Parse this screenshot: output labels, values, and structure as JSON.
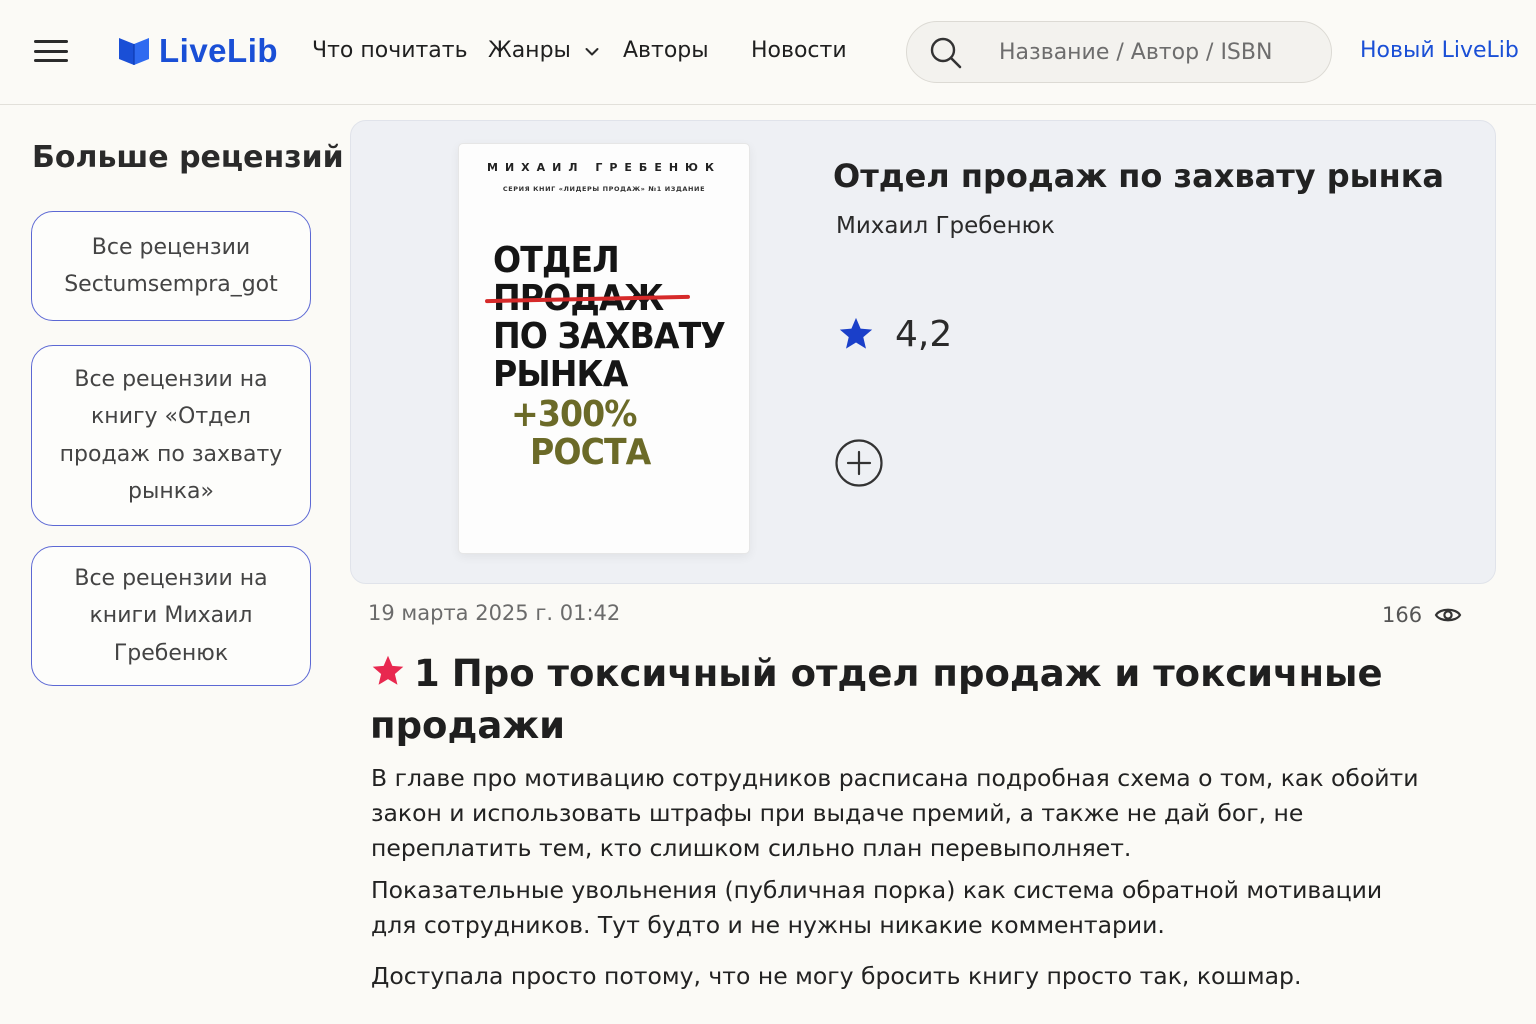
{
  "header": {
    "logo_text": "LiveLib",
    "nav": [
      {
        "label": "Что почитать"
      },
      {
        "label": "Жанры"
      },
      {
        "label": "Авторы"
      },
      {
        "label": "Новости"
      }
    ],
    "search_placeholder": "Название / Автор / ISBN",
    "new_livelib": "Новый LiveLib"
  },
  "sidebar": {
    "title": "Больше рецензий",
    "buttons": [
      {
        "label": "Все рецензии Sectumsempra_got"
      },
      {
        "label": "Все рецензии на книгу «Отдел продаж по захвату рынка»"
      },
      {
        "label": "Все рецензии на книги Михаил Гребенюк"
      }
    ]
  },
  "book": {
    "title": "Отдел продаж по захвату рынка",
    "author": "Михаил Гребенюк",
    "rating": "4,2",
    "cover": {
      "author": "МИХАИЛ ГРЕБЕНЮК",
      "series": "СЕРИЯ КНИГ «ЛИДЕРЫ ПРОДАЖ» №1 ИЗДАНИЕ",
      "line1": "ОТДЕЛ",
      "line2": "ПРОДАЖ",
      "line3": "ПО ЗАХВАТУ",
      "line4": "РЫНКА",
      "line5": "+300%",
      "line6": "РОСТА"
    }
  },
  "review": {
    "date": "19 марта 2025 г. 01:42",
    "views": "166",
    "score": "1",
    "title": "Про токсичный отдел продаж и токсичные продажи",
    "paragraphs": [
      "В главе про мотивацию сотрудников расписана подробная схема о том, как обойти закон и использовать штрафы при выдаче премий, а также не дай бог, не переплатить тем, кто слишком сильно план перевыполняет.",
      "Показательные увольнения (публичная порка) как система обратной мотивации для сотрудников. Тут будто и не нужны никакие комментарии.",
      "Доступала просто потому, что не могу бросить книгу просто так, кошмар."
    ]
  },
  "colors": {
    "brand": "#1a4fd6",
    "rating_star": "#1a3fc9",
    "review_star": "#e8284f",
    "sidebar_border": "#5c68d4"
  },
  "icons": [
    "menu-icon",
    "logo-book-icon",
    "chevron-down-icon",
    "search-icon",
    "star-icon",
    "plus-circle-icon",
    "eye-icon"
  ]
}
